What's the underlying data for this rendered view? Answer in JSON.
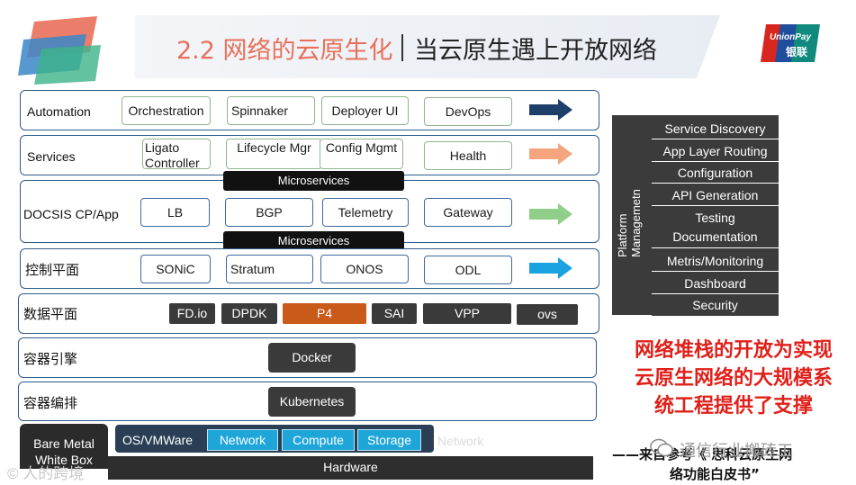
{
  "header": {
    "title_main": "2.2 网络的云原生化",
    "title_sub": "当云原生遇上开放网络",
    "brand_logo_text": "UnionPay 银联"
  },
  "layers": {
    "automation": {
      "label": "Automation",
      "items": [
        "Orchestration",
        "Spinnaker",
        "Deployer UI",
        "DevOps"
      ],
      "arrow_color": "#1f3f6b"
    },
    "services": {
      "label": "Services",
      "items": [
        "Ligato Controller",
        "Lifecycle Mgr",
        "Config Mgmt",
        "Health"
      ],
      "arrow_color": "#f4a57e"
    },
    "docsis": {
      "label": "DOCSIS CP/App",
      "items": [
        "LB",
        "BGP",
        "Telemetry",
        "Gateway"
      ],
      "arrow_color": "#8fcf8a",
      "microservices_top": "Microservices",
      "microservices_bottom": "Microservices"
    },
    "control": {
      "label": "控制平面",
      "items": [
        "SONiC",
        "Stratum",
        "ONOS",
        "ODL"
      ],
      "arrow_color": "#1aa3e0"
    },
    "data": {
      "label": "数据平面",
      "items": [
        "FD.io",
        "DPDK",
        "P4",
        "SAI",
        "VPP",
        "ovs"
      ]
    },
    "container_engine": {
      "label": "容器引擎",
      "item": "Docker"
    },
    "container_orch": {
      "label": "容器编排",
      "item": "Kubernetes"
    }
  },
  "platform": {
    "vertical_label": "Platform Managemetn",
    "items": [
      "Service Discovery",
      "App Layer Routing",
      "Configuration",
      "API Generation",
      "Testing Documentation",
      "Metris/Monitoring",
      "Dashboard",
      "Security"
    ]
  },
  "callout": {
    "lines": [
      "网络堆栈的开放为实现",
      "云原生网络的大规模系",
      "统工程提供了支撑"
    ]
  },
  "bottom": {
    "bare_metal": "Bare Metal White Box",
    "os": "OS/VMWare",
    "os_chips": [
      "Network",
      "Compute",
      "Storage"
    ],
    "faded": "Network",
    "hardware": "Hardware",
    "watermark_left": "© 人的跨境",
    "source_line1": "——来自参考《 思科云原生网",
    "source_line2": "络功能白皮书”",
    "watermark_right": "通信行业搬砖工"
  }
}
